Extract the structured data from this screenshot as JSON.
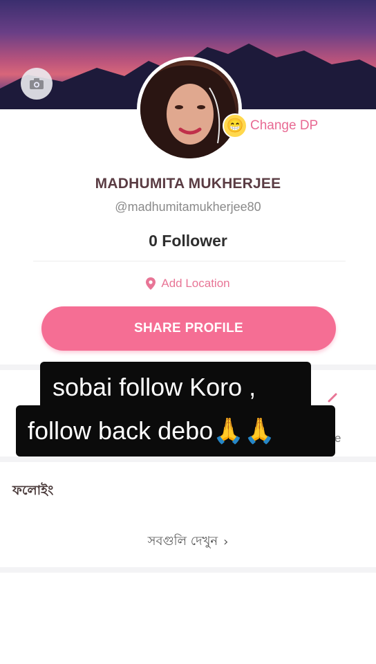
{
  "profile": {
    "change_dp_label": "Change DP",
    "change_dp_emoji": "😁",
    "name": "MADHUMITA MUKHERJEE",
    "handle": "@madhumitamukherjee80",
    "followers": "0 Follower",
    "add_location": "Add Location",
    "share_button": "SHARE PROFILE"
  },
  "overlay": {
    "line1": "sobai follow Koro ,",
    "line2": "follow back debo🙏🙏"
  },
  "partial": {
    "clipped_text": "e"
  },
  "following": {
    "title": "ফলোইং",
    "see_all": "সবগুলি দেখুন",
    "see_all_chevron": "›"
  },
  "colors": {
    "accent": "#f56e94",
    "accent_text": "#e86a93",
    "name_color": "#5a3c43"
  },
  "icons": [
    "camera-icon",
    "location-pin-icon",
    "grinning-face-icon",
    "chevron-right-icon"
  ]
}
